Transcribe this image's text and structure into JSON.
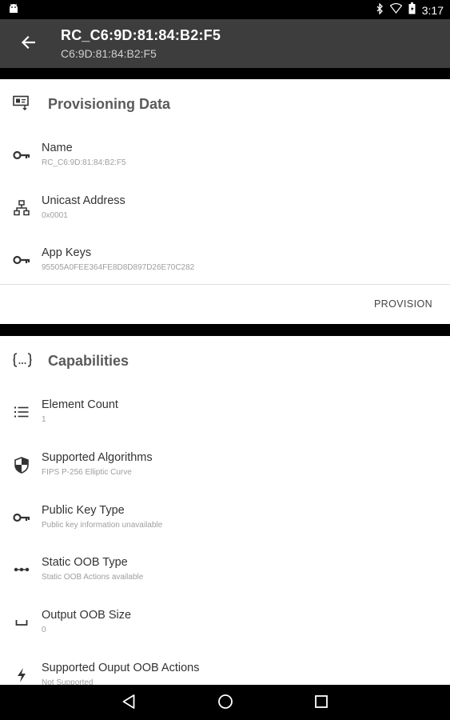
{
  "status_bar": {
    "time": "3:17",
    "icons": [
      "android-icon",
      "bluetooth-icon",
      "wifi-icon",
      "battery-icon"
    ]
  },
  "app_bar": {
    "title": "RC_C6:9D:81:84:B2:F5",
    "subtitle": "C6:9D:81:84:B2:F5",
    "back_icon": "arrow-back-icon"
  },
  "provisioning": {
    "title": "Provisioning Data",
    "icon": "provisioning-icon",
    "rows": [
      {
        "label": "Name",
        "value": "RC_C6:9D:81:84:B2:F5",
        "icon": "key-icon"
      },
      {
        "label": "Unicast Address",
        "value": "0x0001",
        "icon": "network-icon"
      },
      {
        "label": "App Keys",
        "value": "95505A0FEE364FE8D8D897D26E70C282",
        "icon": "key-icon"
      }
    ],
    "action_label": "PROVISION"
  },
  "capabilities": {
    "title": "Capabilities",
    "icon": "braces-icon",
    "rows": [
      {
        "label": "Element Count",
        "value": "1",
        "icon": "list-icon"
      },
      {
        "label": "Supported Algorithms",
        "value": "FIPS P-256 Elliptic Curve",
        "icon": "shield-icon"
      },
      {
        "label": "Public Key Type",
        "value": "Public key information unavailable",
        "icon": "key-icon"
      },
      {
        "label": "Static OOB Type",
        "value": "Static OOB Actions available",
        "icon": "dots-icon"
      },
      {
        "label": "Output OOB Size",
        "value": "0",
        "icon": "space-icon"
      },
      {
        "label": "Supported Ouput OOB Actions",
        "value": "Not Supported",
        "icon": "flash-icon"
      }
    ]
  },
  "nav_bar": {
    "icons": [
      "back-triangle-icon",
      "home-circle-icon",
      "recents-square-icon"
    ]
  },
  "colors": {
    "app_bar": "#3d3d3d",
    "background": "#000000",
    "card": "#ffffff",
    "title_text": "#5a5a5a",
    "secondary_text": "#9e9e9e"
  }
}
